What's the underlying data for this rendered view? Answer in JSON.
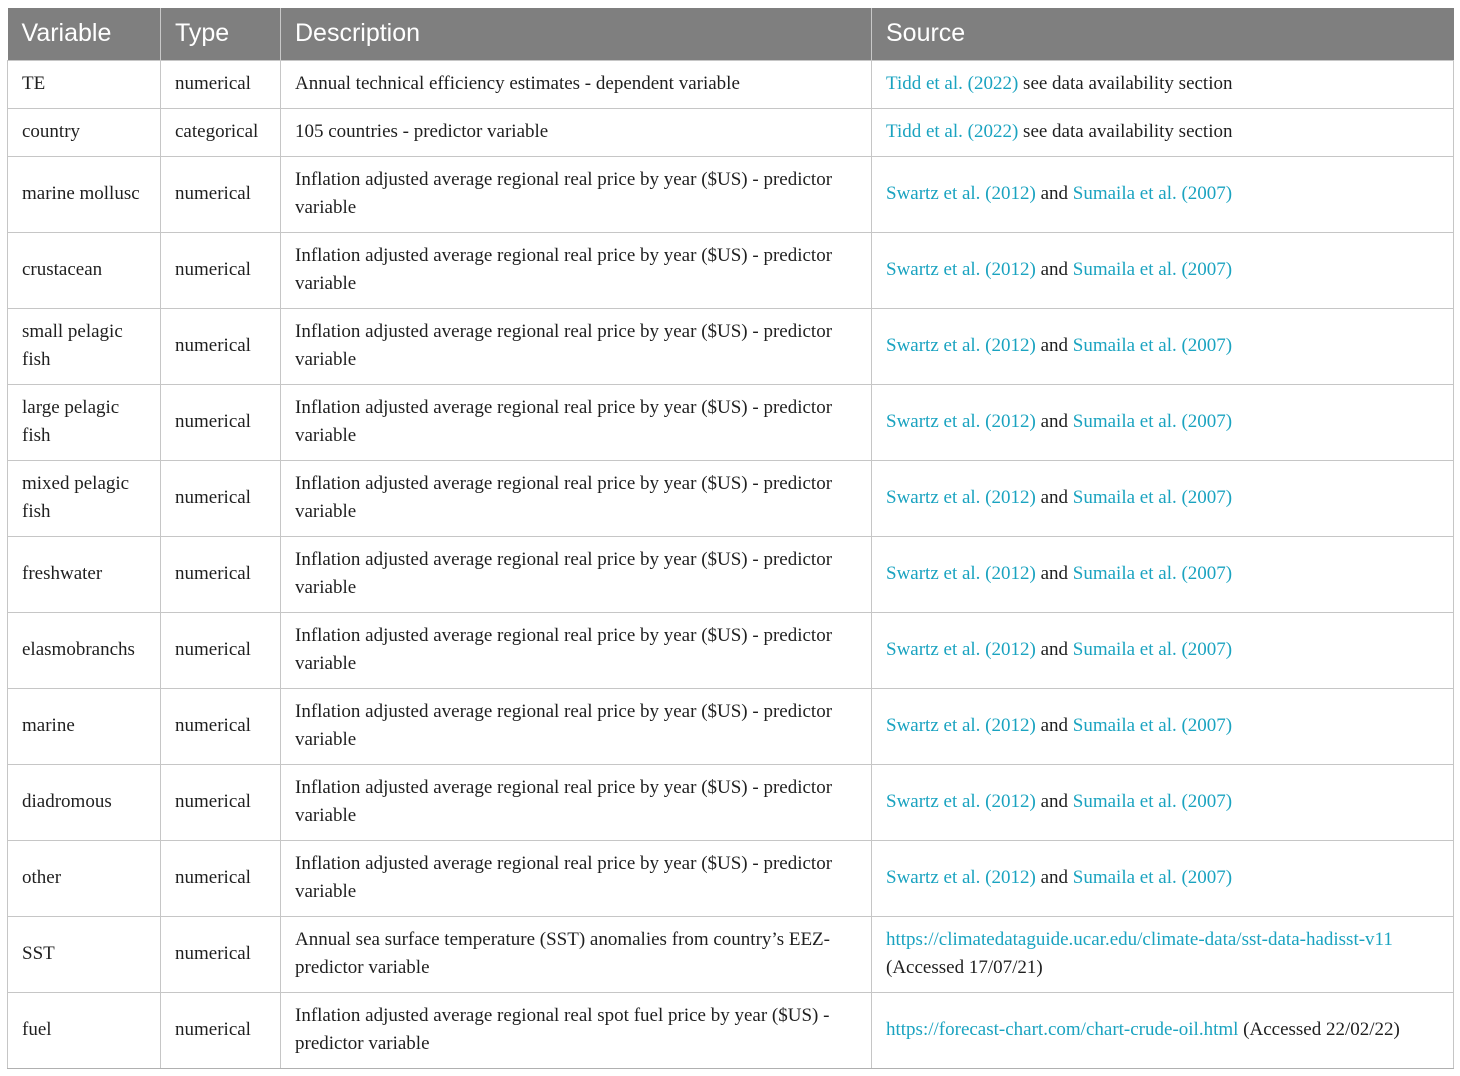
{
  "headers": [
    "Variable",
    "Type",
    "Description",
    "Source"
  ],
  "rows": [
    {
      "variable": "TE",
      "type": "numerical",
      "description": "Annual technical efficiency estimates - dependent variable",
      "source": {
        "link1": "Tidd et al. (2022)",
        "mid": "see data availability section",
        "link2": ""
      }
    },
    {
      "variable": "country",
      "type": "categorical",
      "description": "105 countries - predictor variable",
      "source": {
        "link1": "Tidd et al. (2022)",
        "mid": "see data availability section",
        "link2": ""
      }
    },
    {
      "variable": "marine mollusc",
      "type": "numerical",
      "description": "Inflation adjusted average regional real price by year ($US) - predictor variable",
      "source": {
        "link1": "Swartz et al. (2012)",
        "mid": "and",
        "link2": "Sumaila et al. (2007)"
      }
    },
    {
      "variable": "crustacean",
      "type": "numerical",
      "description": "Inflation adjusted average regional real price by year ($US) - predictor variable",
      "source": {
        "link1": "Swartz et al. (2012)",
        "mid": "and",
        "link2": "Sumaila et al. (2007)"
      }
    },
    {
      "variable": "small pelagic fish",
      "type": "numerical",
      "description": "Inflation adjusted average regional real price by year ($US) - predictor variable",
      "source": {
        "link1": "Swartz et al. (2012)",
        "mid": "and",
        "link2": "Sumaila et al. (2007)"
      }
    },
    {
      "variable": "large pelagic fish",
      "type": "numerical",
      "description": "Inflation adjusted average regional real price by year ($US) - predictor variable",
      "source": {
        "link1": "Swartz et al. (2012)",
        "mid": "and",
        "link2": "Sumaila et al. (2007)"
      }
    },
    {
      "variable": "mixed pelagic fish",
      "type": "numerical",
      "description": "Inflation adjusted average regional real price by year ($US) - predictor variable",
      "source": {
        "link1": "Swartz et al. (2012)",
        "mid": "and",
        "link2": "Sumaila et al. (2007)"
      }
    },
    {
      "variable": "freshwater",
      "type": "numerical",
      "description": "Inflation adjusted average regional real price by year ($US) - predictor variable",
      "source": {
        "link1": "Swartz et al. (2012)",
        "mid": "and",
        "link2": "Sumaila et al. (2007)"
      }
    },
    {
      "variable": "elasmobranchs",
      "type": "numerical",
      "description": "Inflation adjusted average regional real price by year ($US) - predictor variable",
      "source": {
        "link1": "Swartz et al. (2012)",
        "mid": "and",
        "link2": "Sumaila et al. (2007)"
      }
    },
    {
      "variable": "marine",
      "type": "numerical",
      "description": "Inflation adjusted average regional real price by year ($US) - predictor variable",
      "source": {
        "link1": "Swartz et al. (2012)",
        "mid": "and",
        "link2": "Sumaila et al. (2007)"
      }
    },
    {
      "variable": "diadromous",
      "type": "numerical",
      "description": "Inflation adjusted average regional real price by year ($US) - predictor variable",
      "source": {
        "link1": "Swartz et al. (2012)",
        "mid": "and",
        "link2": "Sumaila et al. (2007)"
      }
    },
    {
      "variable": "other",
      "type": "numerical",
      "description": "Inflation adjusted average regional real price by year ($US) - predictor variable",
      "source": {
        "link1": "Swartz et al. (2012)",
        "mid": "and",
        "link2": "Sumaila et al. (2007)"
      }
    },
    {
      "variable": "SST",
      "type": "numerical",
      "description": "Annual sea surface temperature (SST) anomalies from country’s EEZ- predictor variable",
      "source": {
        "link1": "https://climatedataguide.ucar.edu/climate-data/sst-data-hadisst-v11",
        "mid": "(Accessed 17/07/21)",
        "link2": ""
      }
    },
    {
      "variable": "fuel",
      "type": "numerical",
      "description": "Inflation adjusted average regional real spot fuel price by year ($US) - predictor variable",
      "source": {
        "link1": "https://forecast-chart.com/chart-crude-oil.html",
        "mid": "(Accessed 22/02/22)",
        "link2": ""
      }
    }
  ],
  "colors": {
    "header_bg": "#7f7f7f",
    "header_text": "#ffffff",
    "link": "#1aa3c0",
    "border": "#c6c6c6"
  }
}
